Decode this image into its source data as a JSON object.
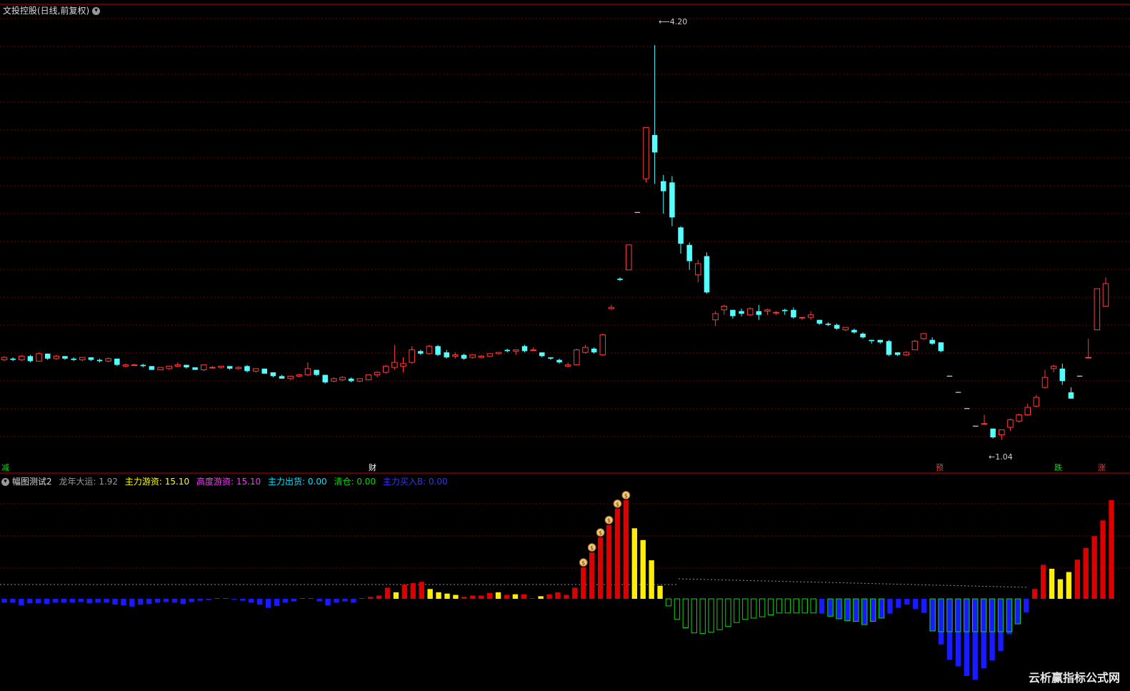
{
  "header": {
    "title": "文投控股(日线,前复权)"
  },
  "indicator": {
    "name": "幅图测试2",
    "items": [
      {
        "label": "龙年大运",
        "value": "1.92",
        "color": "#9a9a9a"
      },
      {
        "label": "主力游资",
        "value": "15.10",
        "color": "#ffff00"
      },
      {
        "label": "高度游资",
        "value": "15.10",
        "color": "#ff33ff"
      },
      {
        "label": "主力出货",
        "value": "0.00",
        "color": "#00e5ff"
      },
      {
        "label": "清仓",
        "value": "0.00",
        "color": "#00dd00"
      },
      {
        "label": "主力买入B",
        "value": "0.00",
        "color": "#3333ff"
      }
    ]
  },
  "markers": [
    {
      "text": "减",
      "color": "#00e000"
    },
    {
      "text": "财",
      "color": "#ffffff"
    },
    {
      "text": "预",
      "color": "#ff3333"
    },
    {
      "text": "跌",
      "color": "#00e000"
    },
    {
      "text": "涨",
      "color": "#ff3333"
    }
  ],
  "annotations": {
    "high": "4.20",
    "low": "1.04"
  },
  "watermark": "云析赢指标公式网",
  "colors": {
    "up": "#ff3b3b",
    "down": "#54ffff",
    "grid": "#7a0000",
    "axis": "#c00000"
  },
  "chart_data": [
    {
      "type": "candlestick",
      "title": "文投控股(日线,前复权)",
      "ylim": [
        0.9,
        4.4
      ],
      "candles": [
        [
          1.68,
          1.7,
          1.71,
          1.67
        ],
        [
          1.69,
          1.68,
          1.7,
          1.67
        ],
        [
          1.68,
          1.71,
          1.72,
          1.67
        ],
        [
          1.71,
          1.67,
          1.72,
          1.66
        ],
        [
          1.67,
          1.73,
          1.74,
          1.67
        ],
        [
          1.73,
          1.69,
          1.73,
          1.68
        ],
        [
          1.69,
          1.71,
          1.72,
          1.68
        ],
        [
          1.71,
          1.69,
          1.71,
          1.68
        ],
        [
          1.69,
          1.68,
          1.7,
          1.67
        ],
        [
          1.68,
          1.7,
          1.7,
          1.67
        ],
        [
          1.7,
          1.68,
          1.7,
          1.67
        ],
        [
          1.68,
          1.67,
          1.69,
          1.66
        ],
        [
          1.67,
          1.69,
          1.7,
          1.66
        ],
        [
          1.69,
          1.64,
          1.69,
          1.63
        ],
        [
          1.63,
          1.64,
          1.65,
          1.62
        ],
        [
          1.64,
          1.64,
          1.65,
          1.63
        ],
        [
          1.64,
          1.63,
          1.65,
          1.62
        ],
        [
          1.63,
          1.6,
          1.63,
          1.6
        ],
        [
          1.6,
          1.62,
          1.62,
          1.6
        ],
        [
          1.61,
          1.63,
          1.63,
          1.6
        ],
        [
          1.63,
          1.64,
          1.66,
          1.62
        ],
        [
          1.64,
          1.62,
          1.64,
          1.61
        ],
        [
          1.62,
          1.6,
          1.62,
          1.6
        ],
        [
          1.6,
          1.64,
          1.64,
          1.59
        ],
        [
          1.62,
          1.62,
          1.63,
          1.61
        ],
        [
          1.62,
          1.63,
          1.63,
          1.61
        ],
        [
          1.63,
          1.61,
          1.63,
          1.6
        ],
        [
          1.61,
          1.62,
          1.63,
          1.6
        ],
        [
          1.63,
          1.59,
          1.64,
          1.58
        ],
        [
          1.59,
          1.61,
          1.61,
          1.58
        ],
        [
          1.61,
          1.57,
          1.61,
          1.57
        ],
        [
          1.58,
          1.55,
          1.58,
          1.54
        ],
        [
          1.55,
          1.53,
          1.56,
          1.53
        ],
        [
          1.53,
          1.55,
          1.55,
          1.52
        ],
        [
          1.55,
          1.56,
          1.57,
          1.54
        ],
        [
          1.56,
          1.61,
          1.66,
          1.55
        ],
        [
          1.6,
          1.56,
          1.6,
          1.55
        ],
        [
          1.56,
          1.5,
          1.56,
          1.49
        ],
        [
          1.51,
          1.53,
          1.54,
          1.5
        ],
        [
          1.52,
          1.54,
          1.55,
          1.51
        ],
        [
          1.53,
          1.51,
          1.54,
          1.5
        ],
        [
          1.51,
          1.53,
          1.53,
          1.5
        ],
        [
          1.52,
          1.56,
          1.56,
          1.52
        ],
        [
          1.56,
          1.58,
          1.59,
          1.54
        ],
        [
          1.58,
          1.63,
          1.64,
          1.57
        ],
        [
          1.62,
          1.66,
          1.8,
          1.6
        ],
        [
          1.63,
          1.65,
          1.7,
          1.58
        ],
        [
          1.66,
          1.76,
          1.79,
          1.65
        ],
        [
          1.75,
          1.73,
          1.76,
          1.72
        ],
        [
          1.73,
          1.79,
          1.8,
          1.72
        ],
        [
          1.79,
          1.72,
          1.8,
          1.71
        ],
        [
          1.74,
          1.7,
          1.76,
          1.69
        ],
        [
          1.71,
          1.72,
          1.74,
          1.69
        ],
        [
          1.72,
          1.69,
          1.73,
          1.68
        ],
        [
          1.7,
          1.72,
          1.72,
          1.69
        ],
        [
          1.7,
          1.71,
          1.72,
          1.69
        ],
        [
          1.71,
          1.73,
          1.73,
          1.71
        ],
        [
          1.73,
          1.74,
          1.74,
          1.72
        ],
        [
          1.76,
          1.75,
          1.77,
          1.74
        ],
        [
          1.75,
          1.76,
          1.76,
          1.72
        ],
        [
          1.79,
          1.75,
          1.8,
          1.74
        ],
        [
          1.76,
          1.76,
          1.78,
          1.75
        ],
        [
          1.74,
          1.71,
          1.74,
          1.7
        ],
        [
          1.7,
          1.69,
          1.7,
          1.68
        ],
        [
          1.68,
          1.66,
          1.69,
          1.65
        ],
        [
          1.63,
          1.64,
          1.66,
          1.62
        ],
        [
          1.64,
          1.76,
          1.77,
          1.64
        ],
        [
          1.74,
          1.78,
          1.8,
          1.73
        ],
        [
          1.77,
          1.74,
          1.78,
          1.73
        ],
        [
          1.72,
          1.88,
          1.89,
          1.71
        ],
        [
          2.09,
          2.1,
          2.12,
          2.08
        ],
        [
          2.33,
          2.32,
          2.34,
          2.31
        ],
        [
          2.4,
          2.6,
          2.6,
          2.41
        ],
        [
          2.86,
          2.86,
          2.86,
          2.86
        ],
        [
          3.13,
          3.54,
          3.54,
          3.1
        ],
        [
          3.48,
          3.34,
          4.2,
          3.09
        ],
        [
          3.11,
          3.03,
          3.16,
          2.85
        ],
        [
          3.1,
          2.82,
          3.15,
          2.75
        ],
        [
          2.74,
          2.61,
          2.75,
          2.53
        ],
        [
          2.6,
          2.47,
          2.62,
          2.4
        ],
        [
          2.36,
          2.45,
          2.48,
          2.3
        ],
        [
          2.51,
          2.22,
          2.54,
          2.21
        ],
        [
          2.0,
          2.05,
          2.07,
          1.95
        ],
        [
          2.08,
          2.11,
          2.12,
          2.04
        ],
        [
          2.08,
          2.03,
          2.08,
          2.01
        ],
        [
          2.07,
          2.05,
          2.09,
          2.03
        ],
        [
          2.04,
          2.09,
          2.1,
          2.03
        ],
        [
          2.07,
          2.04,
          2.12,
          2.0
        ],
        [
          2.07,
          2.08,
          2.09,
          2.04
        ],
        [
          2.06,
          2.06,
          2.07,
          2.04
        ],
        [
          2.08,
          2.07,
          2.09,
          2.04
        ],
        [
          2.08,
          2.02,
          2.1,
          2.01
        ],
        [
          2.02,
          2.02,
          2.02,
          2.0
        ],
        [
          2.02,
          2.04,
          2.07,
          2.0
        ],
        [
          2.0,
          1.97,
          2.0,
          1.96
        ],
        [
          1.97,
          1.96,
          1.98,
          1.95
        ],
        [
          1.96,
          1.93,
          1.97,
          1.92
        ],
        [
          1.92,
          1.94,
          1.94,
          1.91
        ],
        [
          1.92,
          1.9,
          1.93,
          1.89
        ],
        [
          1.89,
          1.86,
          1.9,
          1.85
        ],
        [
          1.84,
          1.83,
          1.84,
          1.81
        ],
        [
          1.84,
          1.82,
          1.84,
          1.81
        ],
        [
          1.83,
          1.72,
          1.84,
          1.71
        ],
        [
          1.74,
          1.72,
          1.74,
          1.71
        ],
        [
          1.72,
          1.74,
          1.75,
          1.71
        ],
        [
          1.76,
          1.83,
          1.84,
          1.76
        ],
        [
          1.85,
          1.89,
          1.89,
          1.84
        ],
        [
          1.84,
          1.81,
          1.86,
          1.8
        ],
        [
          1.82,
          1.75,
          1.82,
          1.74
        ],
        [
          1.55,
          1.55,
          1.55,
          1.55
        ],
        [
          1.42,
          1.42,
          1.42,
          1.42
        ],
        [
          1.29,
          1.29,
          1.29,
          1.29
        ],
        [
          1.15,
          1.15,
          1.15,
          1.15
        ],
        [
          1.17,
          1.17,
          1.24,
          1.16
        ],
        [
          1.13,
          1.06,
          1.13,
          1.05
        ],
        [
          1.08,
          1.12,
          1.12,
          1.04
        ],
        [
          1.14,
          1.2,
          1.21,
          1.11
        ],
        [
          1.19,
          1.24,
          1.25,
          1.18
        ],
        [
          1.24,
          1.3,
          1.33,
          1.23
        ],
        [
          1.31,
          1.38,
          1.4,
          1.3
        ],
        [
          1.46,
          1.54,
          1.6,
          1.45
        ],
        [
          1.61,
          1.63,
          1.64,
          1.58
        ],
        [
          1.61,
          1.51,
          1.65,
          1.48
        ],
        [
          1.42,
          1.37,
          1.46,
          1.37
        ],
        [
          1.55,
          1.55,
          1.55,
          1.55
        ],
        [
          1.7,
          1.7,
          1.85,
          1.7
        ],
        [
          1.92,
          2.25,
          2.25,
          1.92
        ],
        [
          2.11,
          2.29,
          2.34,
          2.11
        ]
      ]
    },
    {
      "type": "bar",
      "title": "幅图测试2",
      "baseline": 0,
      "ylim": [
        -13,
        15.1
      ],
      "values": [
        -0.6,
        -0.6,
        -1.0,
        -0.7,
        -0.7,
        -0.8,
        -0.6,
        -0.6,
        -0.6,
        -0.5,
        -0.7,
        -0.6,
        -0.6,
        -0.9,
        -1.0,
        -1.2,
        -0.9,
        -0.8,
        -0.6,
        -0.5,
        -0.6,
        -0.8,
        -0.5,
        -0.3,
        -0.2,
        0.1,
        0.1,
        -0.1,
        -0.3,
        -0.6,
        -0.9,
        -1.4,
        -1.1,
        -0.6,
        -0.4,
        0.1,
        0.1,
        -0.4,
        -1.0,
        -0.6,
        -0.4,
        -0.6,
        0.1,
        0.3,
        0.5,
        1.7,
        1.0,
        2.2,
        2.4,
        2.6,
        1.5,
        1.0,
        0.8,
        0.6,
        0.3,
        0.5,
        0.5,
        0.9,
        1.0,
        0.6,
        0.7,
        0.7,
        0.0,
        0.4,
        0.7,
        1.0,
        0.6,
        1.7,
        4.8,
        7.1,
        9.4,
        11.3,
        13.8,
        15.1,
        10.8,
        9.0,
        5.9,
        2.0,
        -1.1,
        -3.2,
        -4.5,
        -5.3,
        -5.4,
        -5.2,
        -4.8,
        -4.3,
        -3.7,
        -3.2,
        -3.0,
        -2.8,
        -2.5,
        -2.2,
        -2.2,
        -2.2,
        -2.2,
        -2.2,
        -2.3,
        -2.7,
        -3.1,
        -3.4,
        -3.5,
        -4.0,
        -3.5,
        -3.0,
        -2.3,
        -1.4,
        -0.9,
        -1.6,
        -2.2,
        -5.0,
        -7.1,
        -9.5,
        -10.5,
        -12.0,
        -12.6,
        -10.8,
        -9.6,
        -8.1,
        -5.5,
        -3.9,
        -2.1,
        1.5,
        5.2,
        4.6,
        3.0,
        4.1,
        6.0,
        7.8,
        9.6,
        12.0,
        15.1
      ],
      "categories": [
        "blue",
        "blue",
        "blue",
        "blue",
        "blue",
        "blue",
        "blue",
        "blue",
        "blue",
        "blue",
        "blue",
        "blue",
        "blue",
        "blue",
        "blue",
        "blue",
        "blue",
        "blue",
        "blue",
        "blue",
        "blue",
        "blue",
        "blue",
        "blue",
        "blue",
        "red",
        "red",
        "blue",
        "blue",
        "blue",
        "blue",
        "blue",
        "blue",
        "blue",
        "blue",
        "red",
        "red",
        "blue",
        "blue",
        "blue",
        "blue",
        "blue",
        "red",
        "red",
        "red",
        "red",
        "yellow",
        "red",
        "red",
        "red",
        "yellow",
        "yellow",
        "yellow",
        "yellow",
        "red",
        "red",
        "red",
        "red",
        "yellow",
        "red",
        "yellow",
        "red",
        "blue",
        "yellow",
        "red",
        "red",
        "red",
        "red",
        "red",
        "red",
        "red",
        "red",
        "red",
        "red",
        "yellow",
        "yellow",
        "yellow",
        "yellow",
        "green",
        "green",
        "green",
        "green",
        "green",
        "green",
        "green",
        "green",
        "green",
        "green",
        "green",
        "green",
        "green",
        "green",
        "green",
        "green",
        "green",
        "green",
        "blue",
        "blue",
        "blue",
        "blue",
        "blue",
        "blue",
        "blue",
        "blue",
        "blue",
        "blue",
        "blue",
        "blue",
        "blue",
        "blue",
        "blue",
        "blue",
        "blue",
        "blue",
        "blue",
        "blue",
        "blue",
        "blue",
        "blue",
        "blue",
        "blue",
        "red",
        "red",
        "yellow",
        "yellow",
        "yellow",
        "red",
        "red",
        "red",
        "red",
        "red"
      ]
    }
  ]
}
